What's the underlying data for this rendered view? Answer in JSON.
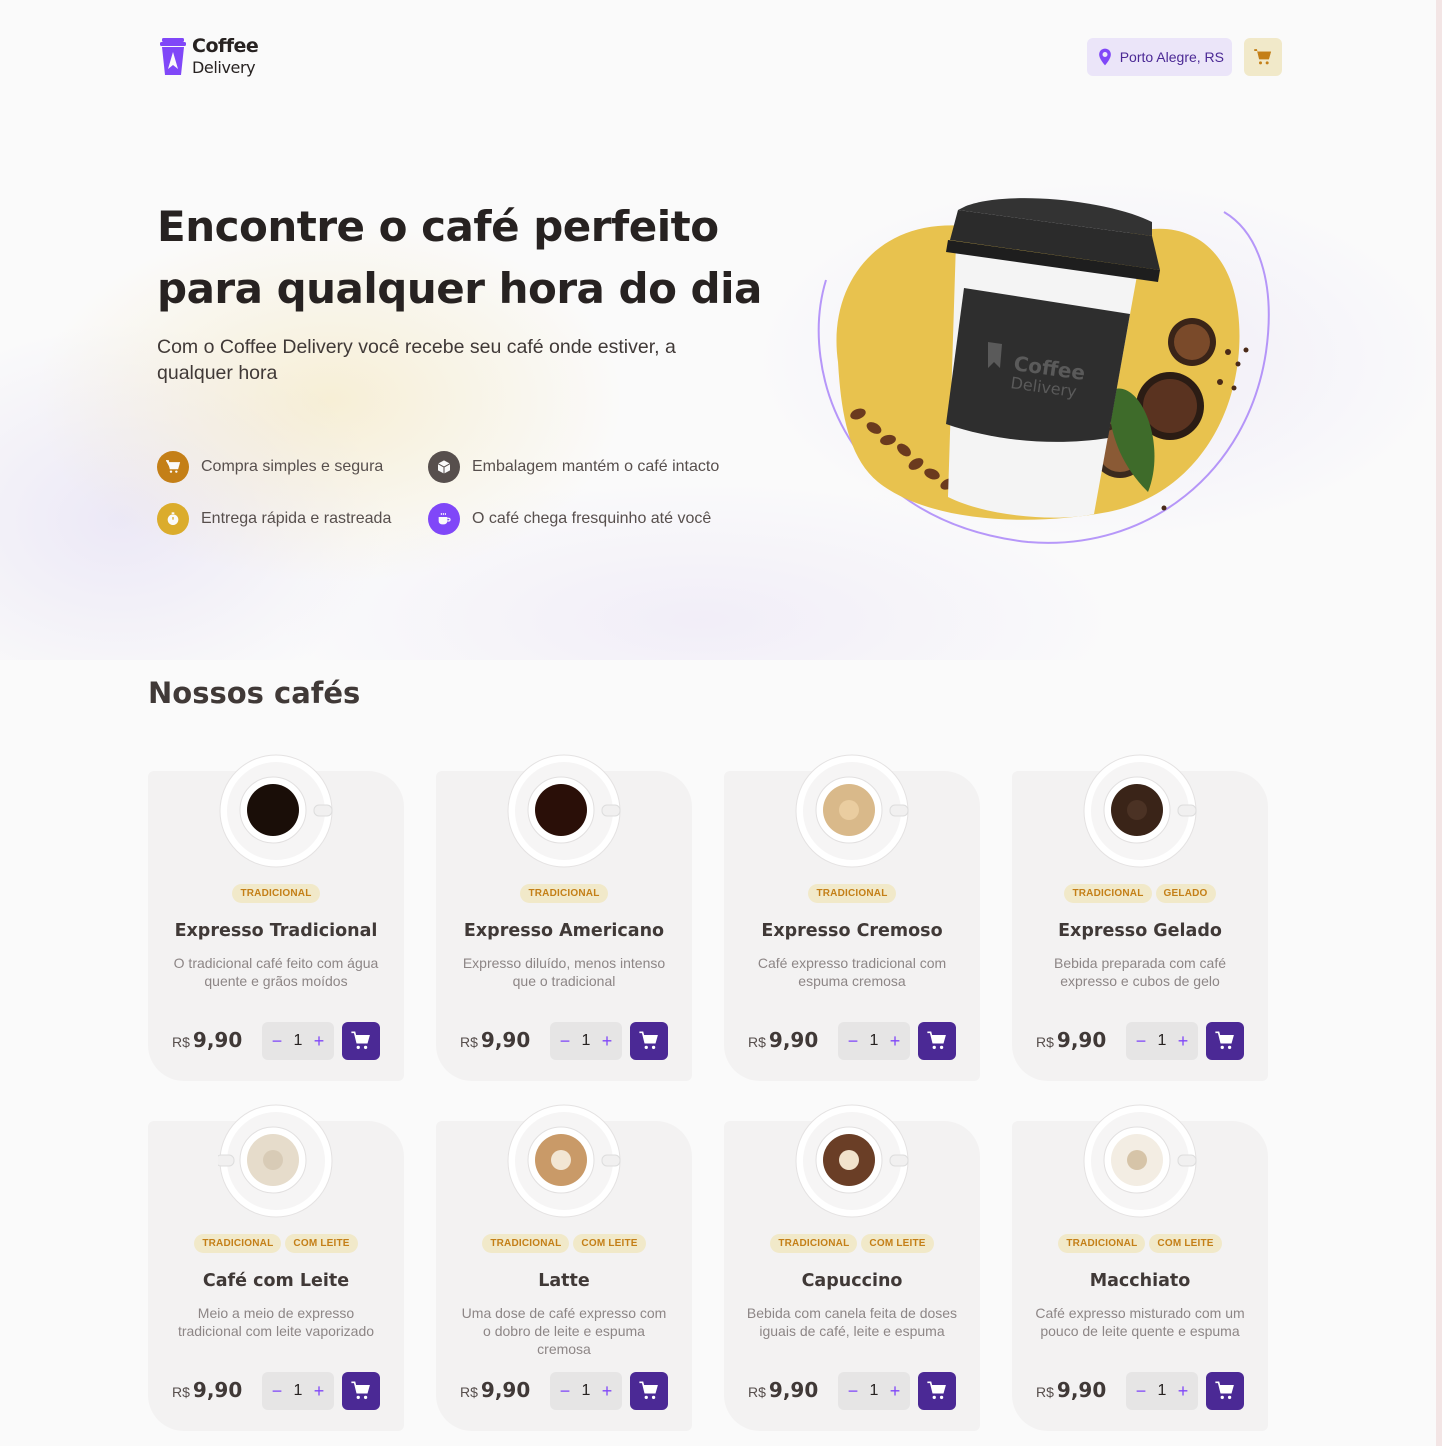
{
  "header": {
    "logo_title": "Coffee",
    "logo_sub": "Delivery",
    "location": "Porto Alegre, RS",
    "cart_icon": "cart-icon"
  },
  "hero": {
    "title": "Encontre o café perfeito para qualquer hora do dia",
    "subtitle": "Com o Coffee Delivery você recebe seu café onde estiver, a qualquer hora",
    "features": [
      {
        "label": "Compra simples e segura",
        "icon": "cart-icon",
        "color": "#C47F17"
      },
      {
        "label": "Embalagem mantém o café intacto",
        "icon": "package-icon",
        "color": "#574F4D"
      },
      {
        "label": "Entrega rápida e rastreada",
        "icon": "timer-icon",
        "color": "#DBAC2C"
      },
      {
        "label": "O café chega fresquinho até você",
        "icon": "coffee-icon",
        "color": "#8047F8"
      }
    ],
    "cup_brand_title": "Coffee",
    "cup_brand_sub": "Delivery"
  },
  "section_title": "Nossos cafés",
  "currency": "R$",
  "products": [
    {
      "name": "Expresso Tradicional",
      "description": "O tradicional café feito com água quente e grãos moídos",
      "tags": [
        "TRADICIONAL"
      ],
      "price": "9,90",
      "quantity": "1"
    },
    {
      "name": "Expresso Americano",
      "description": "Expresso diluído, menos intenso que o tradicional",
      "tags": [
        "TRADICIONAL"
      ],
      "price": "9,90",
      "quantity": "1"
    },
    {
      "name": "Expresso Cremoso",
      "description": "Café expresso tradicional com espuma cremosa",
      "tags": [
        "TRADICIONAL"
      ],
      "price": "9,90",
      "quantity": "1"
    },
    {
      "name": "Expresso Gelado",
      "description": "Bebida preparada com café expresso e cubos de gelo",
      "tags": [
        "TRADICIONAL",
        "GELADO"
      ],
      "price": "9,90",
      "quantity": "1"
    },
    {
      "name": "Café com Leite",
      "description": "Meio a meio de expresso tradicional com leite vaporizado",
      "tags": [
        "TRADICIONAL",
        "COM LEITE"
      ],
      "price": "9,90",
      "quantity": "1"
    },
    {
      "name": "Latte",
      "description": "Uma dose de café expresso com o dobro de leite e espuma cremosa",
      "tags": [
        "TRADICIONAL",
        "COM LEITE"
      ],
      "price": "9,90",
      "quantity": "1"
    },
    {
      "name": "Capuccino",
      "description": "Bebida com canela feita de doses iguais de café, leite e espuma",
      "tags": [
        "TRADICIONAL",
        "COM LEITE"
      ],
      "price": "9,90",
      "quantity": "1"
    },
    {
      "name": "Macchiato",
      "description": "Café expresso misturado com um pouco de leite quente e espuma",
      "tags": [
        "TRADICIONAL",
        "COM LEITE"
      ],
      "price": "9,90",
      "quantity": "1"
    }
  ],
  "colors": {
    "purple_dark": "#4B2995",
    "purple": "#8047F8",
    "yellow": "#DBAC2C",
    "yellow_dark": "#C47F17",
    "yellow_light": "#F1E9C9"
  }
}
